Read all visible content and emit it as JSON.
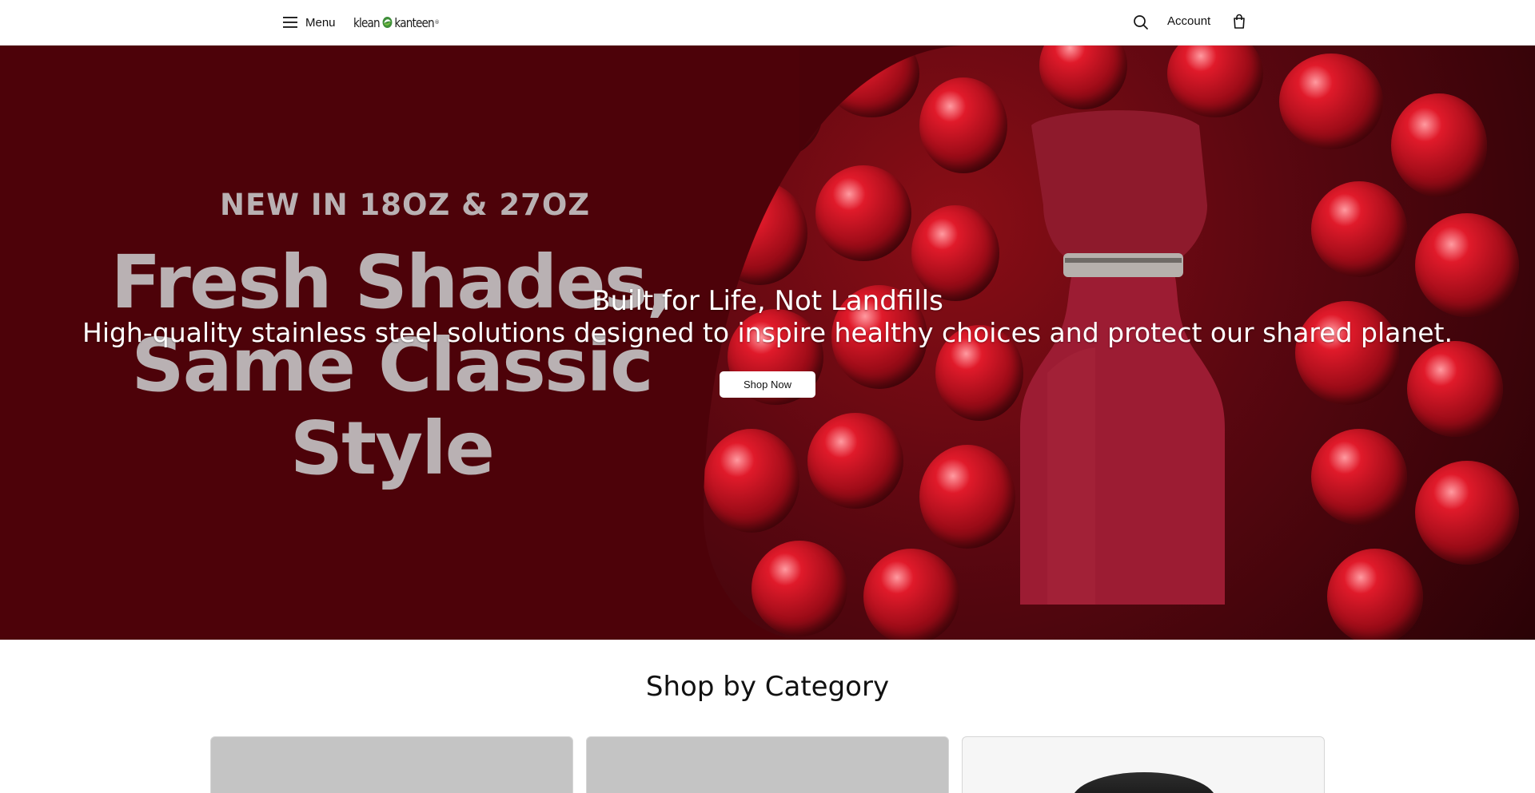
{
  "header": {
    "menu_label": "Menu",
    "logo_text_left": "klean",
    "logo_text_right": "kanteen",
    "account_label": "Account",
    "icons": [
      "hamburger-icon",
      "leaf-logo-icon",
      "search-icon",
      "shopping-bag-icon"
    ]
  },
  "hero": {
    "art_small": "NEW IN 18OZ & 27OZ",
    "art_big_line1": "Fresh Shades,",
    "art_big_line2": "Same Classic",
    "art_big_line3": "Style",
    "title": "Built for Life, Not Landfills",
    "subtitle": "High-quality stainless steel solutions designed to inspire healthy choices and protect our shared planet.",
    "cta_label": "Shop Now",
    "colors": {
      "background": "#4d0209",
      "bottle": "#9c1c33",
      "accent": "#ffffff"
    }
  },
  "categories": {
    "title": "Shop by Category",
    "cards": [
      {
        "name": "category-card-1"
      },
      {
        "name": "category-card-2"
      },
      {
        "name": "category-card-3"
      }
    ]
  }
}
